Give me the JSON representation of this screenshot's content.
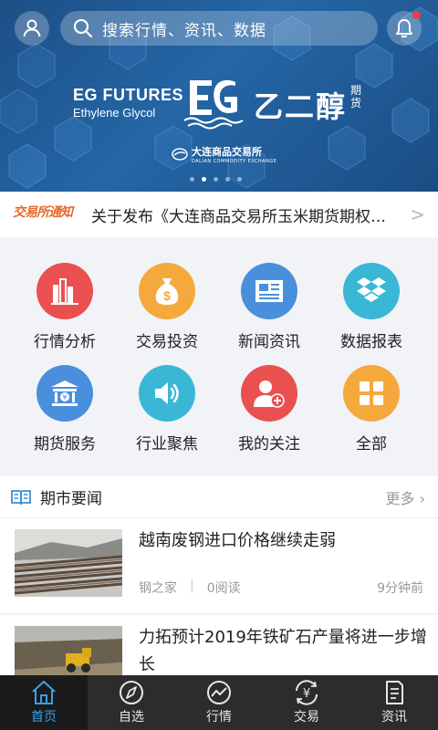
{
  "header": {
    "search_placeholder": "搜索行情、资讯、数据",
    "notification_badge": true
  },
  "banner": {
    "en_line1": "EG FUTURES",
    "en_line2": "Ethylene Glycol",
    "logo_text": "EG",
    "cn_title": "乙二醇",
    "cn_suffix": "期货",
    "exchange_cn": "大连商品交易所",
    "exchange_en": "DALIAN COMMODITY EXCHANGE",
    "slide_count": 5,
    "active_slide": 1
  },
  "notice": {
    "badge": "交易所通知",
    "text": "关于发布《大连商品交易所玉米期货期权…",
    "arrow": ">"
  },
  "menu": {
    "items": [
      {
        "label": "行情分析",
        "icon": "bar-chart-icon",
        "color": "#e9504f"
      },
      {
        "label": "交易投资",
        "icon": "money-bag-icon",
        "color": "#f5a93c"
      },
      {
        "label": "新闻资讯",
        "icon": "newspaper-icon",
        "color": "#4a8fdc"
      },
      {
        "label": "数据报表",
        "icon": "dropbox-icon",
        "color": "#3bb7d6"
      },
      {
        "label": "期货服务",
        "icon": "bank-icon",
        "color": "#4a8fdc"
      },
      {
        "label": "行业聚焦",
        "icon": "speaker-icon",
        "color": "#3bb7d6"
      },
      {
        "label": "我的关注",
        "icon": "add-user-icon",
        "color": "#e9504f"
      },
      {
        "label": "全部",
        "icon": "grid-icon",
        "color": "#f5a93c"
      }
    ]
  },
  "news": {
    "header": "期市要闻",
    "more": "更多",
    "items": [
      {
        "title": "越南废钢进口价格继续走弱",
        "source": "钢之家",
        "reads": "0阅读",
        "time": "9分钟前"
      },
      {
        "title": "力拓预计2019年铁矿石产量将进一步增长",
        "source": "",
        "reads": "",
        "time": ""
      }
    ]
  },
  "nav": {
    "items": [
      {
        "label": "首页",
        "icon": "home-icon"
      },
      {
        "label": "自选",
        "icon": "compass-icon"
      },
      {
        "label": "行情",
        "icon": "trend-icon"
      },
      {
        "label": "交易",
        "icon": "yuan-exchange-icon"
      },
      {
        "label": "资讯",
        "icon": "document-icon"
      }
    ],
    "active": 0
  },
  "colors": {
    "accent": "#39a1e8",
    "banner": "#1d4f86",
    "nav_bg": "#2c2c2c"
  }
}
